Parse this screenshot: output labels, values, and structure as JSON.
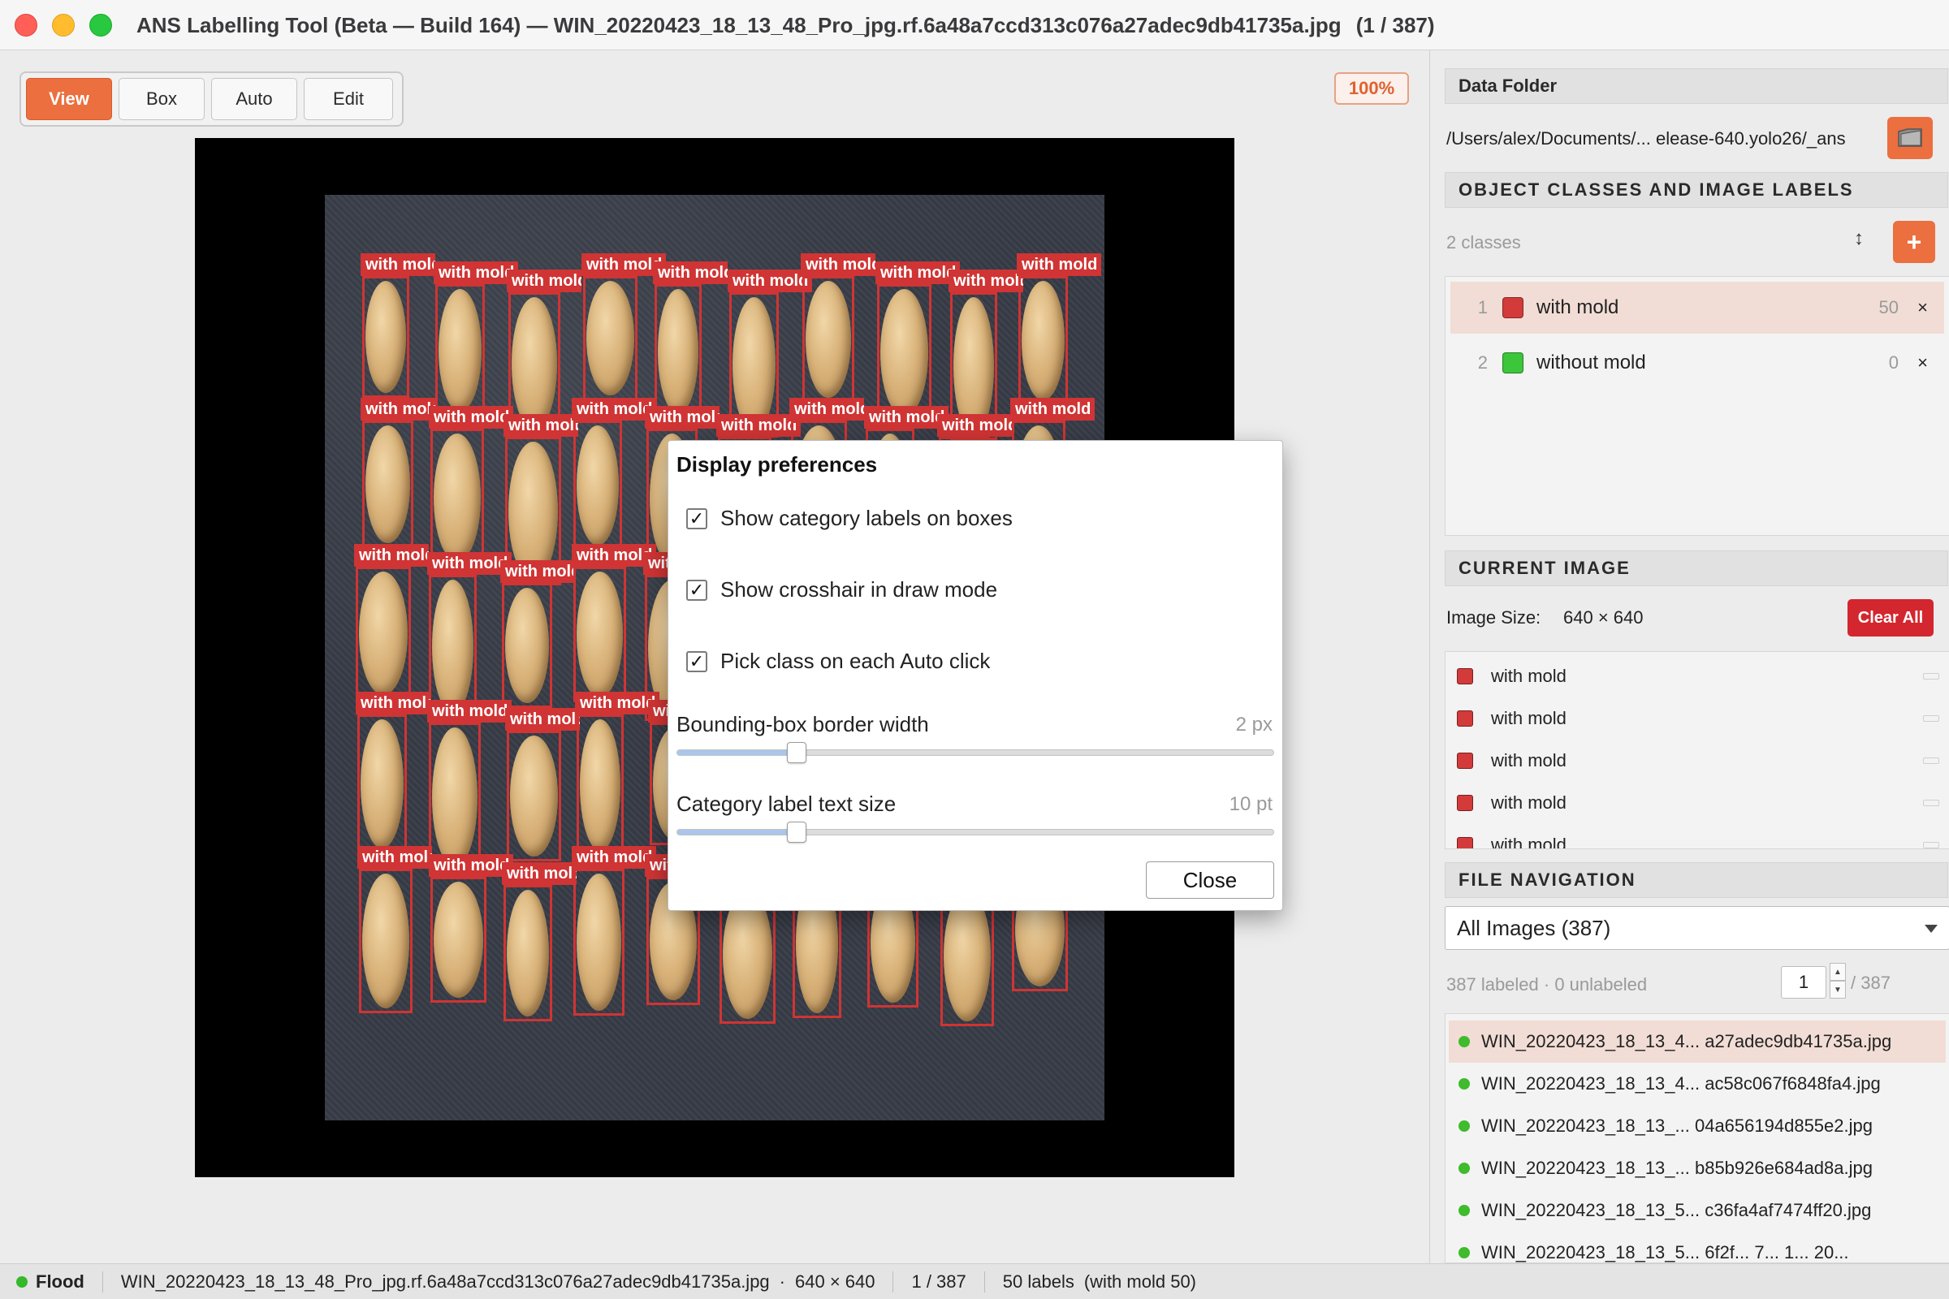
{
  "window": {
    "title": "ANS Labelling Tool (Beta — Build 164) — WIN_20220423_18_13_48_Pro_jpg.rf.6a48a7ccd313c076a27adec9db41735a.jpg",
    "image_counter": "(1 / 387)"
  },
  "toolbar": {
    "modes": [
      "View",
      "Box",
      "Auto",
      "Edit"
    ],
    "active_mode": "View",
    "zoom": "100%"
  },
  "canvas": {
    "box_label": "with mold"
  },
  "dialog": {
    "title": "Display preferences",
    "options": [
      {
        "label": "Show category labels on boxes",
        "checked": true
      },
      {
        "label": "Show crosshair in draw mode",
        "checked": true
      },
      {
        "label": "Pick class on each Auto click",
        "checked": true
      }
    ],
    "check_glyph": "✓",
    "sliders": [
      {
        "label": "Bounding-box border width",
        "value": "2 px",
        "fraction": 0.2
      },
      {
        "label": "Category label text size",
        "value": "10 pt",
        "fraction": 0.2
      }
    ],
    "close_label": "Close"
  },
  "data_folder": {
    "header": "Data Folder",
    "path": "/Users/alex/Documents/... elease-640.yolo26/_ans"
  },
  "classes": {
    "header": "OBJECT CLASSES AND IMAGE LABELS",
    "summary": "2 classes",
    "sort_glyph": "↕",
    "add_glyph": "+",
    "remove_glyph": "×",
    "items": [
      {
        "index": "1",
        "name": "with mold",
        "count": "50",
        "color": "#d33a3a"
      },
      {
        "index": "2",
        "name": "without mold",
        "count": "0",
        "color": "#3cc63a"
      }
    ]
  },
  "current_image": {
    "header": "CURRENT IMAGE",
    "size_label": "Image Size:",
    "size_value": "640 × 640",
    "clear_label": "Clear All",
    "labels": [
      "with mold",
      "with mold",
      "with mold",
      "with mold",
      "with mold"
    ]
  },
  "file_nav": {
    "header": "FILE NAVIGATION",
    "filter": "All Images (387)",
    "stats": "387 labeled · 0 unlabeled",
    "page": "1",
    "total": "/ 387",
    "step_up": "▲",
    "step_down": "▼",
    "files": [
      "WIN_20220423_18_13_4... a27adec9db41735a.jpg",
      "WIN_20220423_18_13_4... ac58c067f6848fa4.jpg",
      "WIN_20220423_18_13_... 04a656194d855e2.jpg",
      "WIN_20220423_18_13_... b85b926e684ad8a.jpg",
      "WIN_20220423_18_13_5... c36fa4af7474ff20.jpg",
      "WIN_20220423_18_13_5... 6f2f... 7... 1... 20..."
    ]
  },
  "status": {
    "mode": "Flood",
    "file": "WIN_20220423_18_13_48_Pro_jpg.rf.6a48a7ccd313c076a27adec9db41735a.jpg",
    "dims": "640 × 640",
    "counter": "1 / 387",
    "labels": "50 labels",
    "breakdown": "(with mold 50)"
  }
}
